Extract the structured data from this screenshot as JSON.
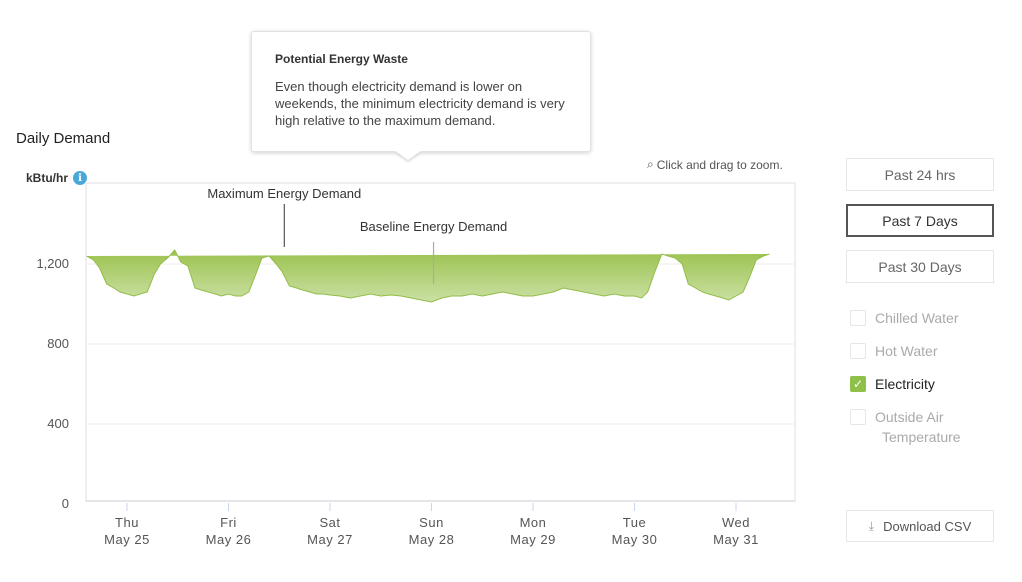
{
  "title": "Daily Demand",
  "unit_label": "kBtu/hr",
  "info_icon": "i",
  "zoom_hint": "Click and drag to zoom.",
  "tooltip": {
    "title": "Potential Energy Waste",
    "body": "Even though electricity demand is lower on weekends, the minimum electricity demand is very high relative to the maximum demand."
  },
  "range_buttons": [
    {
      "label": "Past 24 hrs",
      "active": false
    },
    {
      "label": "Past 7 Days",
      "active": true
    },
    {
      "label": "Past 30 Days",
      "active": false
    }
  ],
  "series_toggles": [
    {
      "label": "Chilled Water",
      "checked": false
    },
    {
      "label": "Hot Water",
      "checked": false
    },
    {
      "label": "Electricity",
      "checked": true
    },
    {
      "label": "Outside Air",
      "label2": "Temperature",
      "checked": false
    }
  ],
  "download_label": "Download CSV",
  "colors": {
    "fill_top": "#9bc24e",
    "fill_bottom": "#cbe0a4",
    "accent": "#8fc04a",
    "info": "#4aa8d8"
  },
  "chart_data": {
    "type": "area",
    "title": "Daily Demand",
    "ylabel": "kBtu/hr",
    "xlabel": "",
    "ylim": [
      0,
      1600
    ],
    "yticks": [
      0,
      400,
      800,
      1200
    ],
    "ytick_labels": [
      "0",
      "400",
      "800",
      "1,200"
    ],
    "grid": true,
    "x_unit": "days since Thu May 25 00:00",
    "xlim": [
      -0.4,
      6.6
    ],
    "xticks": [
      0,
      1,
      2,
      3,
      4,
      5,
      6
    ],
    "xtick_labels": [
      [
        "Thu",
        "May 25"
      ],
      [
        "Fri",
        "May 26"
      ],
      [
        "Sat",
        "May 27"
      ],
      [
        "Sun",
        "May 28"
      ],
      [
        "Mon",
        "May 29"
      ],
      [
        "Tue",
        "May 30"
      ],
      [
        "Wed",
        "May 31"
      ]
    ],
    "series": [
      {
        "name": "Electricity",
        "x": [
          -0.4,
          -0.33,
          -0.27,
          -0.2,
          -0.13,
          -0.07,
          0,
          0.07,
          0.13,
          0.2,
          0.27,
          0.33,
          0.4,
          0.47,
          0.53,
          0.6,
          0.67,
          0.73,
          0.8,
          0.87,
          0.93,
          1,
          1.07,
          1.13,
          1.2,
          1.27,
          1.33,
          1.4,
          1.47,
          1.53,
          1.6,
          1.67,
          1.73,
          1.8,
          1.87,
          1.93,
          2,
          2.1,
          2.2,
          2.3,
          2.4,
          2.5,
          2.6,
          2.7,
          2.8,
          2.9,
          3,
          3.1,
          3.2,
          3.3,
          3.4,
          3.5,
          3.6,
          3.7,
          3.8,
          3.9,
          4,
          4.1,
          4.2,
          4.3,
          4.4,
          4.5,
          4.6,
          4.7,
          4.8,
          4.9,
          5,
          5.07,
          5.13,
          5.2,
          5.27,
          5.33,
          5.4,
          5.47,
          5.53,
          5.6,
          5.67,
          5.73,
          5.8,
          5.87,
          5.93,
          6,
          6.07,
          6.13,
          6.2,
          6.27,
          6.33,
          6.4,
          6.47,
          6.53,
          6.6
        ],
        "values": [
          1240,
          1220,
          1180,
          1100,
          1080,
          1060,
          1050,
          1040,
          1050,
          1060,
          1150,
          1200,
          1230,
          1270,
          1210,
          1190,
          1080,
          1070,
          1060,
          1050,
          1040,
          1050,
          1040,
          1040,
          1060,
          1150,
          1230,
          1240,
          1200,
          1160,
          1090,
          1080,
          1070,
          1060,
          1050,
          1050,
          1045,
          1040,
          1030,
          1040,
          1050,
          1040,
          1045,
          1040,
          1030,
          1020,
          1010,
          1030,
          1040,
          1040,
          1050,
          1040,
          1050,
          1060,
          1050,
          1040,
          1040,
          1050,
          1060,
          1080,
          1070,
          1060,
          1050,
          1040,
          1050,
          1040,
          1040,
          1030,
          1060,
          1160,
          1250,
          1240,
          1230,
          1200,
          1100,
          1080,
          1060,
          1050,
          1040,
          1030,
          1020,
          1040,
          1060,
          1130,
          1220,
          1240,
          1250
        ]
      }
    ],
    "annotations": [
      {
        "text": "Maximum Energy Demand",
        "x": 1.55,
        "y": 1240
      },
      {
        "text": "Baseline Energy Demand",
        "x": 3.02,
        "y": 1050
      }
    ]
  }
}
